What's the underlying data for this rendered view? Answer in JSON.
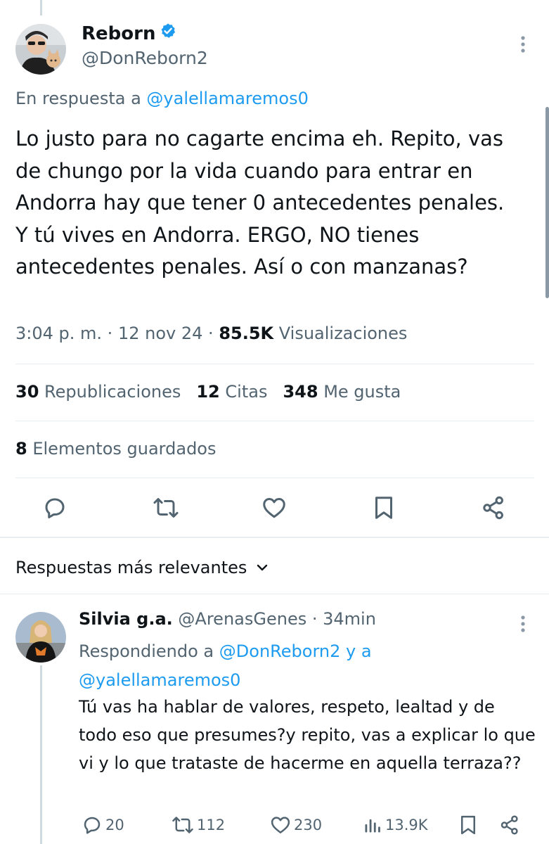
{
  "tweet": {
    "author_name": "Reborn",
    "author_handle": "@DonReborn2",
    "reply_prefix": "En respuesta a",
    "reply_to_handle": "@yalellamaremos0",
    "text": "Lo justo para no cagarte encima eh. Repito, vas de chungo por la vida cuando para entrar en Andorra hay que tener 0 antecedentes penales. Y tú vives en Andorra. ERGO, NO tienes antecedentes penales. Así o con manzanas?",
    "time": "3:04 p. m.",
    "date": "12 nov 24",
    "views_count": "85.5K",
    "views_label": "Visualizaciones",
    "separator": "·",
    "stats": {
      "reposts_count": "30",
      "reposts_label": "Republicaciones",
      "quotes_count": "12",
      "quotes_label": "Citas",
      "likes_count": "348",
      "likes_label": "Me gusta",
      "bookmarks_count": "8",
      "bookmarks_label": "Elementos guardados"
    },
    "verified_color": "#1d9bf0"
  },
  "replies_sort": {
    "label": "Respuestas más relevantes"
  },
  "reply": {
    "name": "Silvia g.a.",
    "handle": "@ArenasGenes",
    "separator": "·",
    "time": "34min",
    "responding_prefix": "Respondiendo a",
    "responding_to_1": "@DonReborn2",
    "responding_and": "y a",
    "responding_to_2": "@yalellamaremos0",
    "text": "Tú vas ha hablar de valores, respeto, lealtad y de todo eso que presumes?y repito, vas a explicar lo que vi y lo que trataste de hacerme en aquella terraza??",
    "actions": {
      "replies": "20",
      "reposts": "112",
      "likes": "230",
      "views": "13.9K"
    }
  },
  "colors": {
    "link": "#1d9bf0",
    "secondary_text": "#536471",
    "primary_text": "#0f1419",
    "divider": "#e6ecf0"
  }
}
